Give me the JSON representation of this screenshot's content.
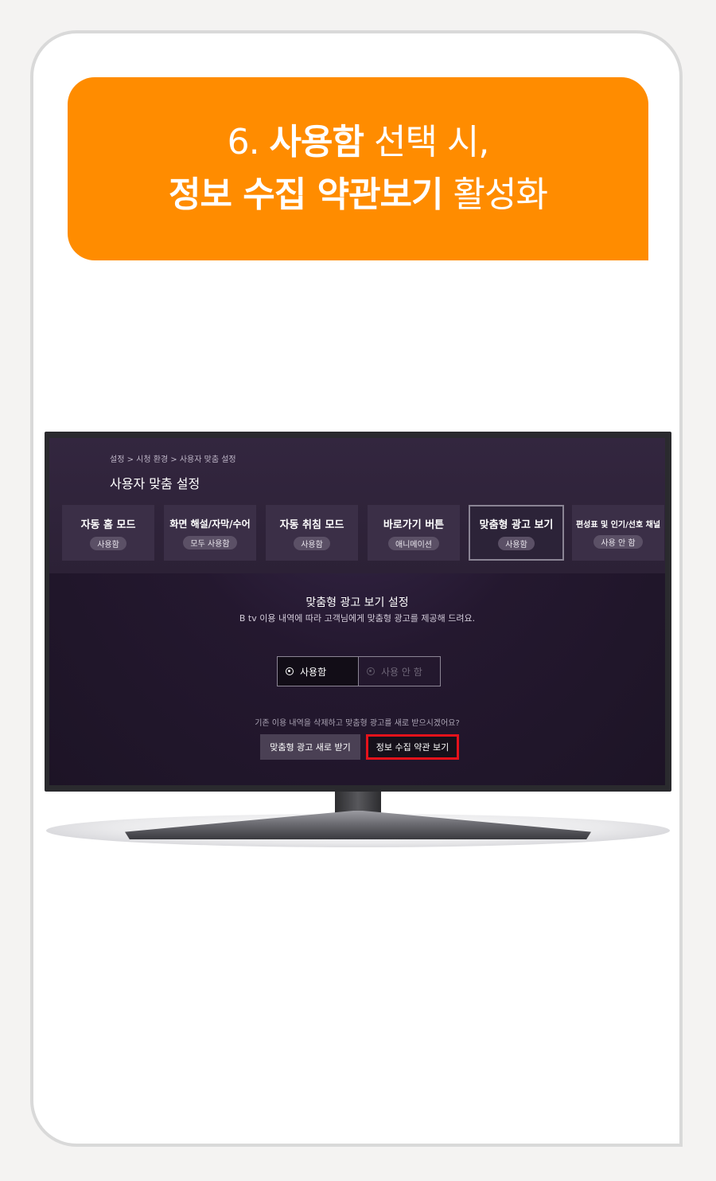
{
  "banner": {
    "line1": {
      "number": "6. ",
      "bold": "사용함",
      "regular": " 선택 시,"
    },
    "line2": {
      "bold": "정보 수집 약관보기",
      "regular": " 활성화"
    }
  },
  "tv": {
    "breadcrumb": "설정 > 시청 환경 > 사용자 맞춤 설정",
    "title": "사용자 맞춤 설정",
    "tiles": [
      {
        "title": "자동 홈 모드",
        "value": "사용함"
      },
      {
        "title": "화면 해설/자막/수어",
        "value": "모두 사용함"
      },
      {
        "title": "자동 취침 모드",
        "value": "사용함"
      },
      {
        "title": "바로가기 버튼",
        "value": "애니메이션"
      },
      {
        "title": "맞춤형 광고 보기",
        "value": "사용함",
        "selected": true
      },
      {
        "title": "편성표 및 인기/선호 채널",
        "value": "사용 안 함"
      }
    ],
    "panel": {
      "title": "맞춤형 광고 보기 설정",
      "description": "B tv 이용 내역에 따라 고객님에게 맞춤형 광고를 제공해 드려요.",
      "options": [
        "사용함",
        "사용 안 함"
      ],
      "selected_option": "사용함",
      "question": "기존 이용 내역을 삭제하고 맞춤형 광고를 새로 받으시겠어요?",
      "renew_button": "맞춤형 광고 새로 받기",
      "terms_button": "정보 수집 약관 보기"
    }
  },
  "colors": {
    "accent": "#ff8c00",
    "highlight": "#e5121b",
    "screen_bg": "#24182f"
  }
}
